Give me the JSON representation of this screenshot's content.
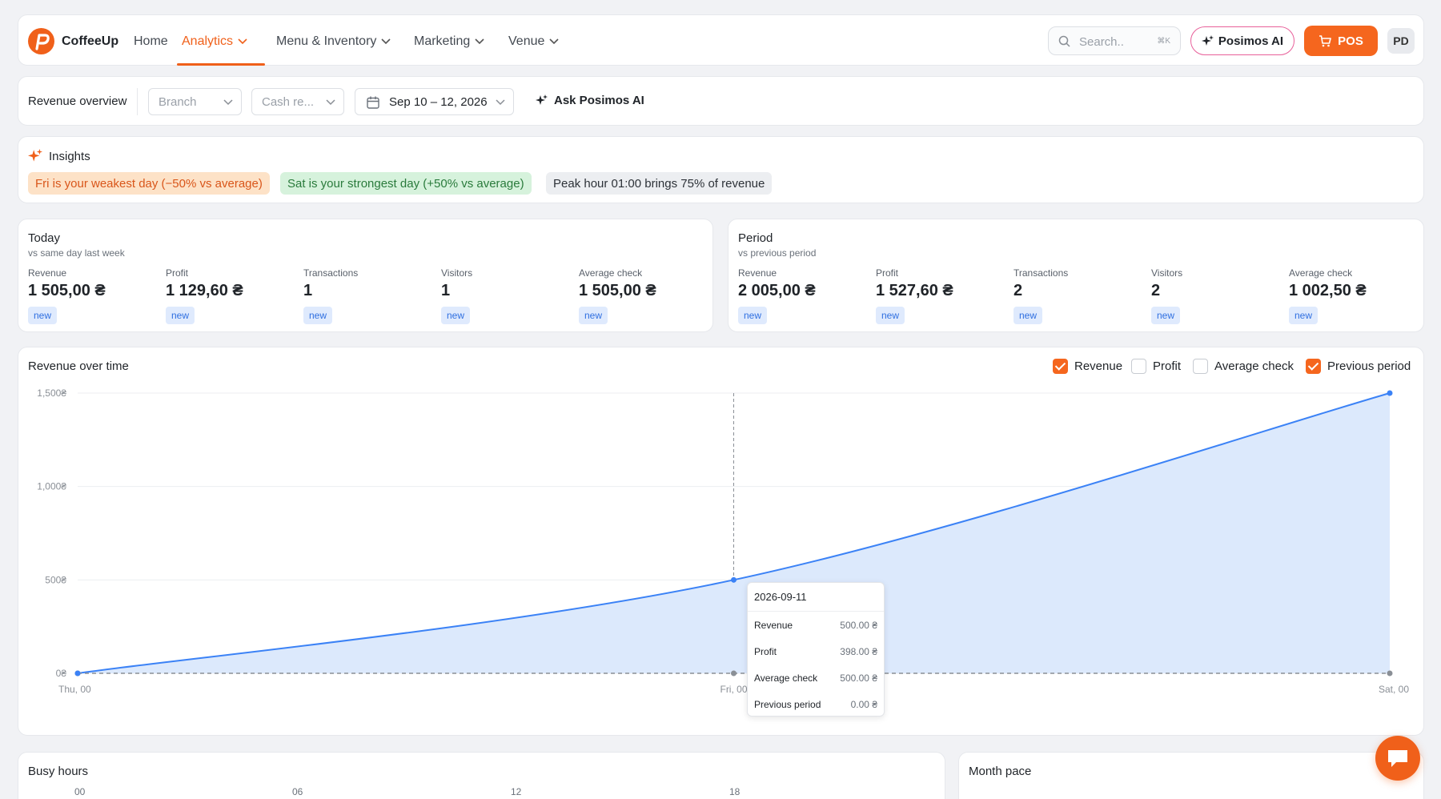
{
  "nav": {
    "brand": "CoffeeUp",
    "items": [
      {
        "label": "Home"
      },
      {
        "label": "Analytics"
      },
      {
        "label": "Menu & Inventory"
      },
      {
        "label": "Marketing"
      },
      {
        "label": "Venue"
      }
    ],
    "search_placeholder": "Search..",
    "search_shortcut": "⌘K",
    "ai_label": "Posimos AI",
    "pos_label": "POS",
    "avatar": "PD",
    "accent": "#f0601a"
  },
  "filters": {
    "title": "Revenue overview",
    "branch": "Branch",
    "cash_register": "Cash re...",
    "date_range": "Sep 10 – 12, 2026",
    "ask_ai": "Ask Posimos AI"
  },
  "insights": {
    "title": "Insights",
    "chips": [
      "Fri is your weakest day (−50% vs average)",
      "Sat is your strongest day (+50% vs average)",
      "Peak hour 01:00 brings 75% of revenue"
    ]
  },
  "today": {
    "title": "Today",
    "subtitle": "vs same day last week",
    "kpis": [
      {
        "label": "Revenue",
        "value": "1 505,00 ₴",
        "badge": "new"
      },
      {
        "label": "Profit",
        "value": "1 129,60 ₴",
        "badge": "new"
      },
      {
        "label": "Transactions",
        "value": "1",
        "badge": "new"
      },
      {
        "label": "Visitors",
        "value": "1",
        "badge": "new"
      },
      {
        "label": "Average check",
        "value": "1 505,00 ₴",
        "badge": "new"
      }
    ]
  },
  "period": {
    "title": "Period",
    "subtitle": "vs previous period",
    "kpis": [
      {
        "label": "Revenue",
        "value": "2 005,00 ₴",
        "badge": "new"
      },
      {
        "label": "Profit",
        "value": "1 527,60 ₴",
        "badge": "new"
      },
      {
        "label": "Transactions",
        "value": "2",
        "badge": "new"
      },
      {
        "label": "Visitors",
        "value": "2",
        "badge": "new"
      },
      {
        "label": "Average check",
        "value": "1 002,50 ₴",
        "badge": "new"
      }
    ]
  },
  "chart_section": {
    "title": "Revenue over time",
    "legend": [
      {
        "label": "Revenue",
        "checked": true
      },
      {
        "label": "Profit",
        "checked": false
      },
      {
        "label": "Average check",
        "checked": false
      },
      {
        "label": "Previous period",
        "checked": true
      }
    ],
    "tooltip": {
      "date": "2026-09-11",
      "rows": [
        {
          "label": "Revenue",
          "value": "500.00 ₴"
        },
        {
          "label": "Profit",
          "value": "398.00 ₴"
        },
        {
          "label": "Average check",
          "value": "500.00 ₴"
        },
        {
          "label": "Previous period",
          "value": "0.00 ₴"
        }
      ]
    }
  },
  "chart_data": {
    "type": "area",
    "x": [
      "Thu, 00",
      "Fri, 00",
      "Sat, 00"
    ],
    "series": [
      {
        "name": "Revenue",
        "values": [
          0,
          500,
          1500
        ],
        "color": "#3b82f6"
      },
      {
        "name": "Previous period",
        "values": [
          0,
          0,
          0
        ],
        "color": "#8a8f96"
      }
    ],
    "yticks": [
      "0₴",
      "500₴",
      "1,000₴",
      "1,500₴"
    ],
    "ylim": [
      0,
      1500
    ]
  },
  "busy_hours": {
    "title": "Busy hours",
    "hours": [
      "00",
      "06",
      "12",
      "18"
    ]
  },
  "month_pace": {
    "title": "Month pace"
  }
}
